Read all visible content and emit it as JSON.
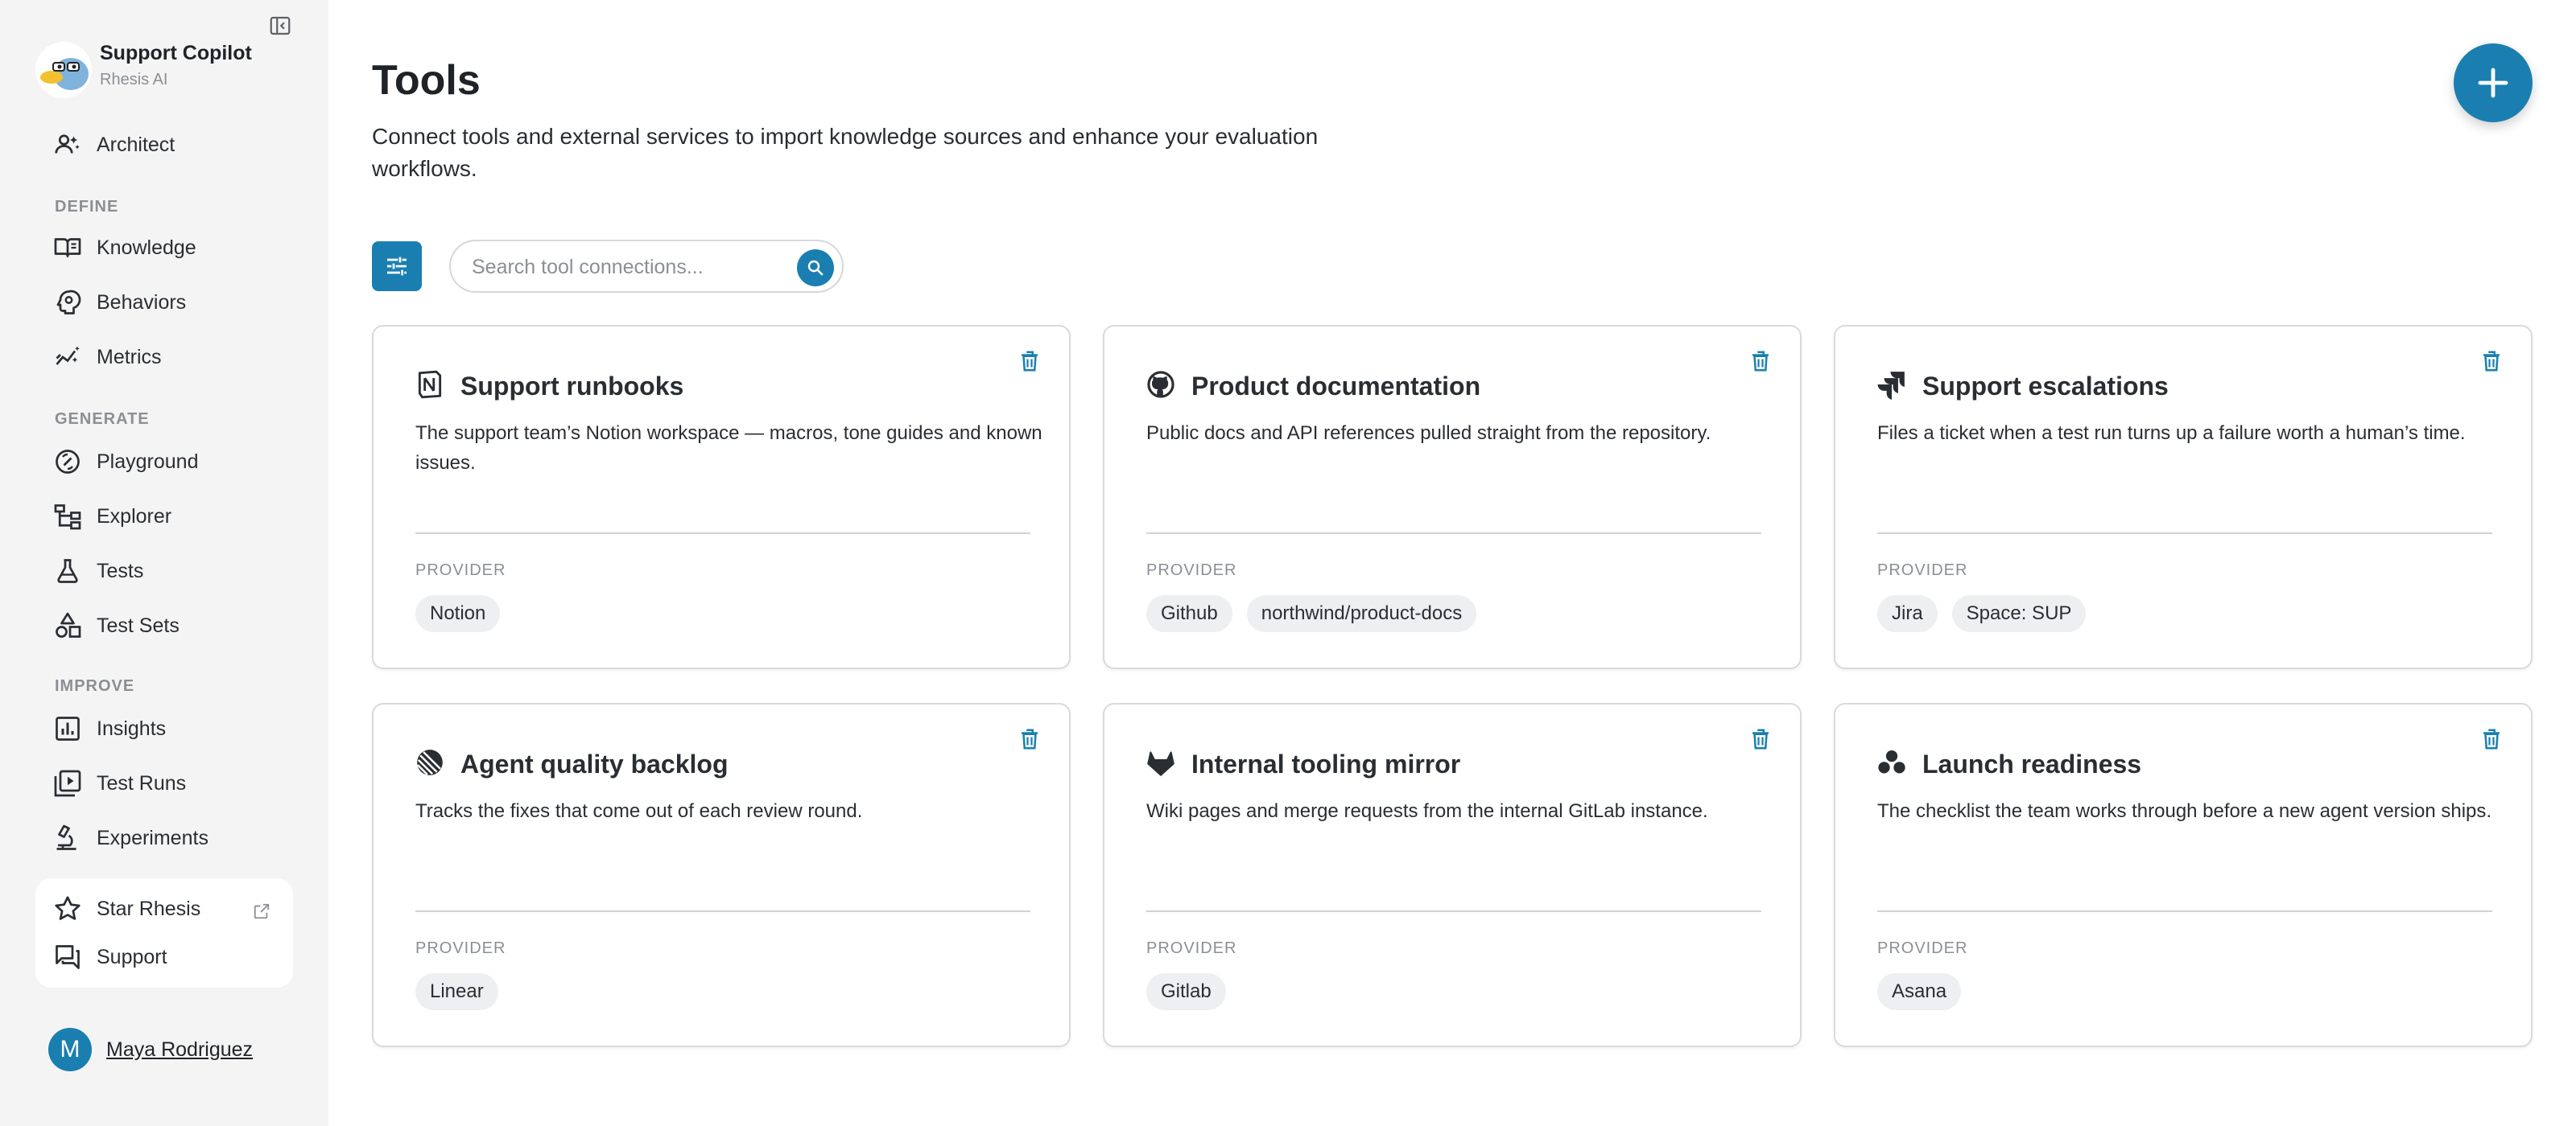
{
  "sidebar": {
    "org_name": "Support Copilot",
    "org_sub": "Rhesis AI",
    "architect_label": "Architect",
    "sections": {
      "define": "DEFINE",
      "generate": "GENERATE",
      "improve": "IMPROVE"
    },
    "items": {
      "knowledge": "Knowledge",
      "behaviors": "Behaviors",
      "metrics": "Metrics",
      "playground": "Playground",
      "explorer": "Explorer",
      "tests": "Tests",
      "test_sets": "Test Sets",
      "insights": "Insights",
      "test_runs": "Test Runs",
      "experiments": "Experiments"
    },
    "star_label": "Star Rhesis",
    "support_label": "Support",
    "user_initial": "M",
    "user_name": "Maya Rodriguez"
  },
  "main": {
    "title": "Tools",
    "description": "Connect tools and external services to import knowledge sources and enhance your evaluation workflows.",
    "search_placeholder": "Search tool connections...",
    "provider_label": "PROVIDER",
    "cards": [
      {
        "icon": "notion-icon",
        "title": "Support runbooks",
        "description": "The support team’s Notion workspace — macros, tone guides and known issues.",
        "chips": [
          "Notion"
        ]
      },
      {
        "icon": "github-icon",
        "title": "Product documentation",
        "description": "Public docs and API references pulled straight from the repository.",
        "chips": [
          "Github",
          "northwind/product-docs"
        ]
      },
      {
        "icon": "jira-icon",
        "title": "Support escalations",
        "description": "Files a ticket when a test run turns up a failure worth a human’s time.",
        "chips": [
          "Jira",
          "Space: SUP"
        ]
      },
      {
        "icon": "linear-icon",
        "title": "Agent quality backlog",
        "description": "Tracks the fixes that come out of each review round.",
        "chips": [
          "Linear"
        ]
      },
      {
        "icon": "gitlab-icon",
        "title": "Internal tooling mirror",
        "description": "Wiki pages and merge requests from the internal GitLab instance.",
        "chips": [
          "Gitlab"
        ]
      },
      {
        "icon": "asana-icon",
        "title": "Launch readiness",
        "description": "The checklist the team works through before a new agent version ships.",
        "chips": [
          "Asana"
        ]
      }
    ]
  },
  "colors": {
    "accent": "#1a7fb0",
    "sidebar_bg": "#f4f4f4",
    "chip_bg": "#eeeff1"
  }
}
